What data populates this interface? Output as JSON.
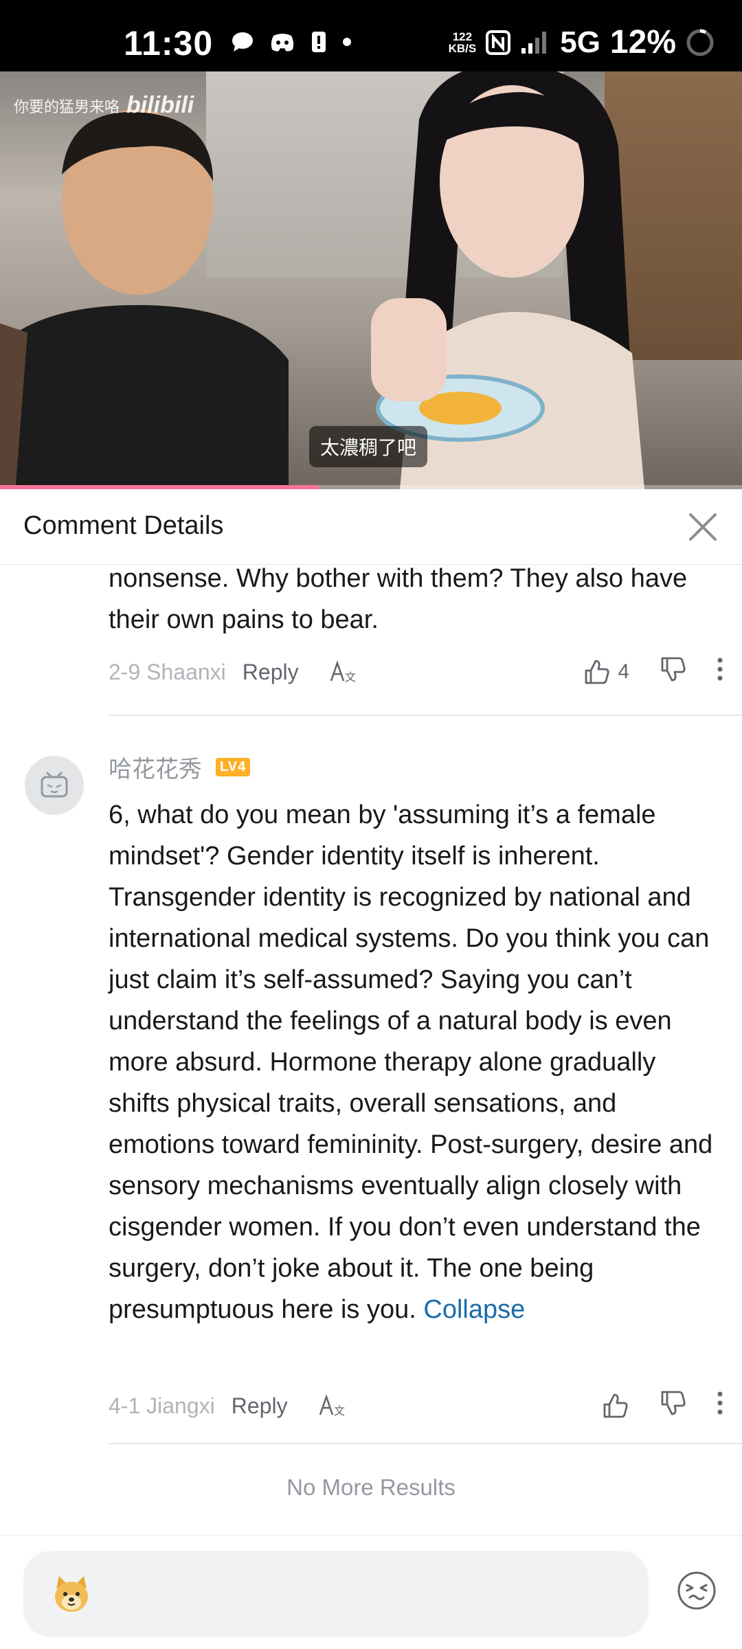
{
  "status_bar": {
    "time": "11:30",
    "net_speed_value": "122",
    "net_speed_unit": "KB/S",
    "network": "5G",
    "battery": "12%"
  },
  "video": {
    "watermark_text": "你要的猛男来咯",
    "platform_logo": "bilibili",
    "subtitle": "太濃稠了吧",
    "progress_fraction": 0.43
  },
  "panel": {
    "title": "Comment Details"
  },
  "comments": [
    {
      "text": "nonsense. Why bother with them? They also have their own pains to bear.",
      "date": "2-9",
      "location": "Shaanxi",
      "reply_label": "Reply",
      "likes": "4"
    },
    {
      "username": "哈花花秀",
      "level": "LV4",
      "text": "6, what do you mean by 'assuming it’s a female mindset'? Gender identity itself is inherent. Transgender identity is recognized by national and international medical systems. Do you think you can just claim it’s self-assumed? Saying you can’t understand the feelings of a natural body is even more absurd. Hormone therapy alone gradually shifts physical traits, overall sensations, and emotions toward femininity. Post-surgery, desire and sensory mechanisms eventually align closely with cisgender women. If you don’t even understand the surgery, don’t joke about it. The one being presumptuous here is you.",
      "collapse_label": "Collapse",
      "date": "4-1",
      "location": "Jiangxi",
      "reply_label": "Reply"
    }
  ],
  "no_more_results": "No More Results",
  "icons": {
    "close": "close-icon",
    "like": "thumbs-up-icon",
    "dislike": "thumbs-down-icon",
    "more": "more-vertical-icon",
    "translate": "translate-icon",
    "emoji": "emoji-face-icon",
    "sticker": "doge-sticker-icon"
  },
  "colors": {
    "accent_pink": "#fb7299",
    "link_blue": "#1a6dab",
    "level_badge": "#ffb027"
  }
}
